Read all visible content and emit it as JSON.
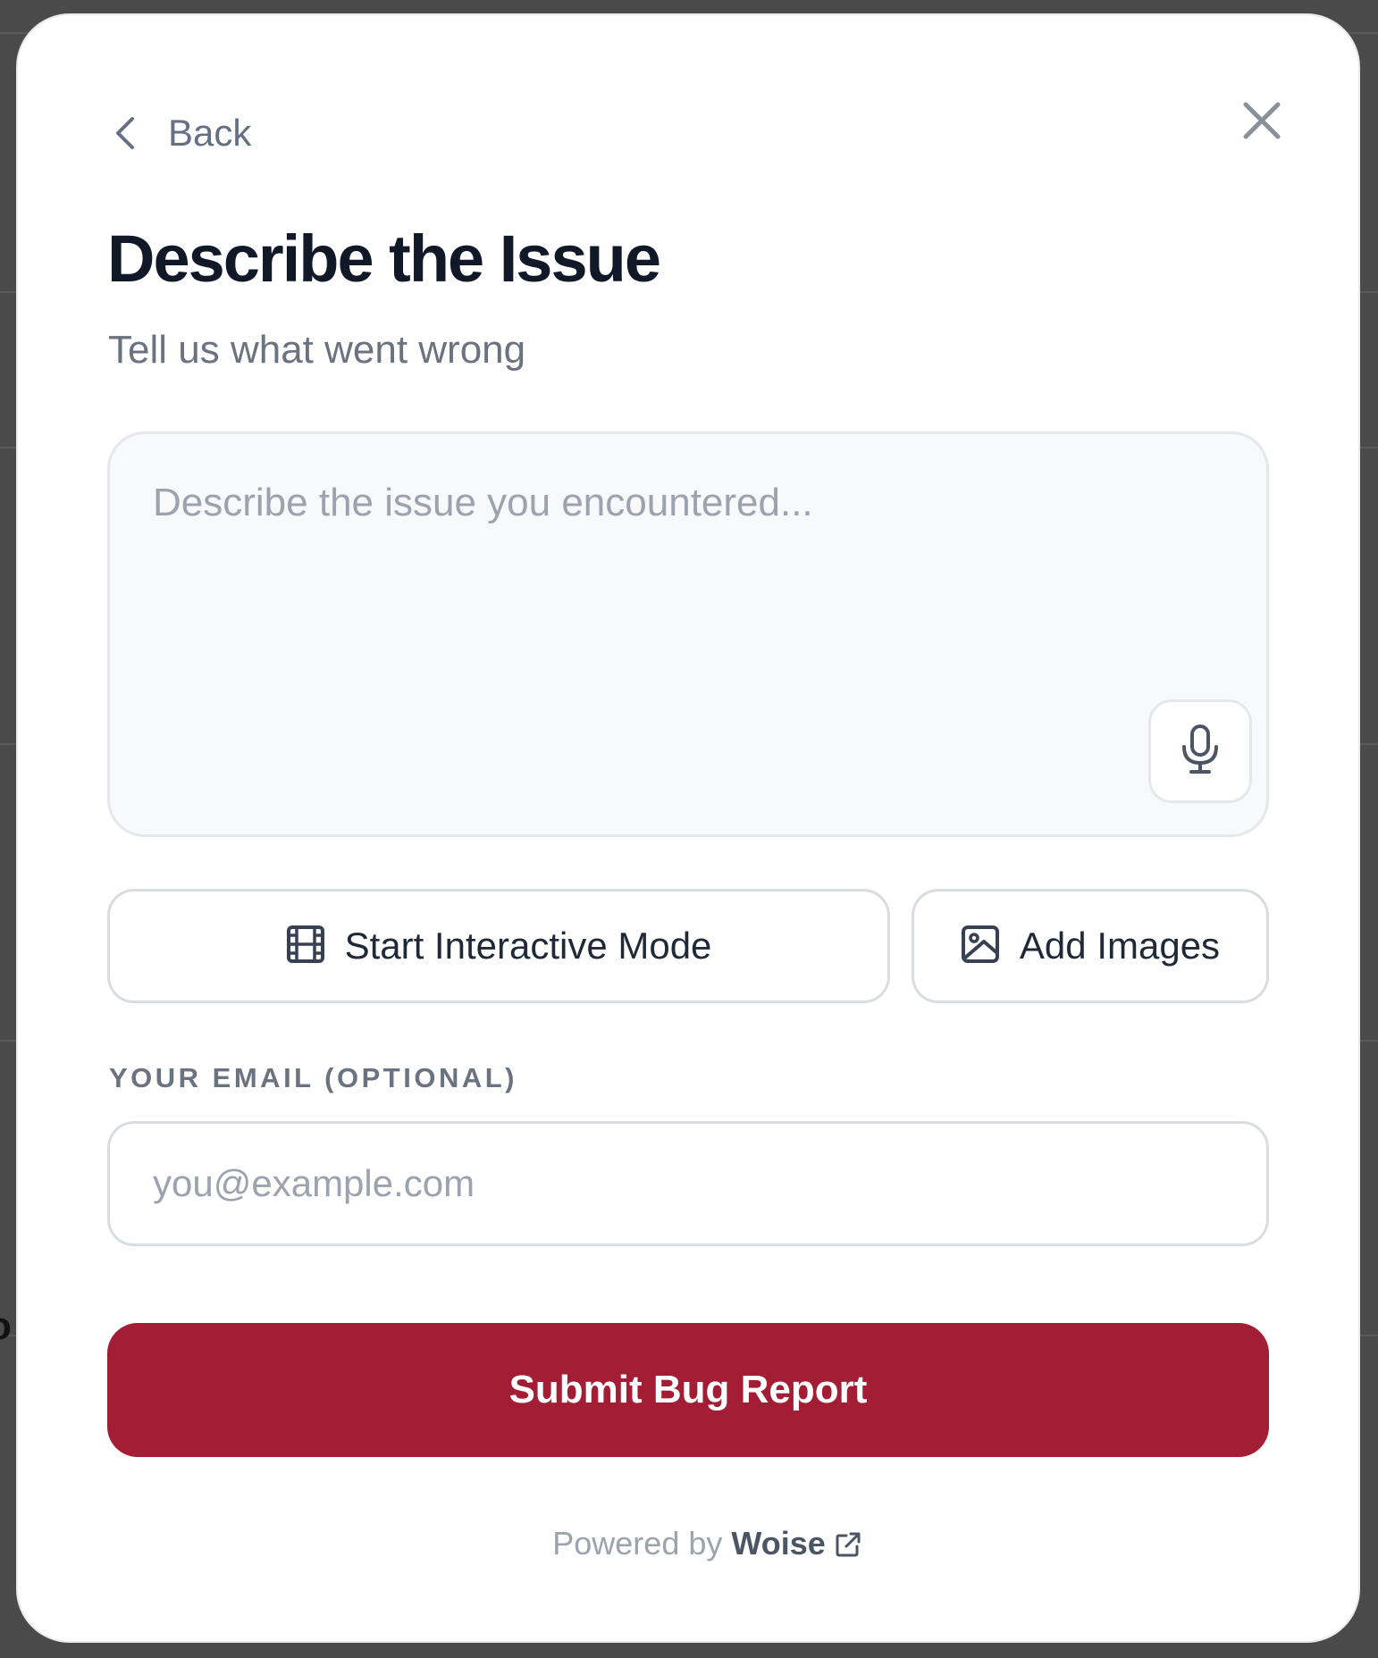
{
  "nav": {
    "back_label": "Back"
  },
  "header": {
    "title": "Describe the Issue",
    "subtitle": "Tell us what went wrong"
  },
  "description": {
    "placeholder": "Describe the issue you encountered...",
    "value": ""
  },
  "actions": {
    "interactive_mode_label": "Start Interactive Mode",
    "add_images_label": "Add Images"
  },
  "email": {
    "label": "YOUR EMAIL (OPTIONAL)",
    "placeholder": "you@example.com",
    "value": ""
  },
  "submit": {
    "label": "Submit Bug Report"
  },
  "footer": {
    "powered_prefix": "Powered by",
    "brand": "Woise"
  },
  "icons": {
    "back": "chevron-left-icon",
    "close": "close-icon",
    "mic": "microphone-icon",
    "interactive": "film-icon",
    "images": "image-icon",
    "external": "external-link-icon"
  },
  "colors": {
    "primary": "#a31e34",
    "title": "#111827",
    "muted": "#6b7280",
    "placeholder": "#9ca3af",
    "field_bg": "#f8f9fb",
    "border": "#d9dce1"
  }
}
